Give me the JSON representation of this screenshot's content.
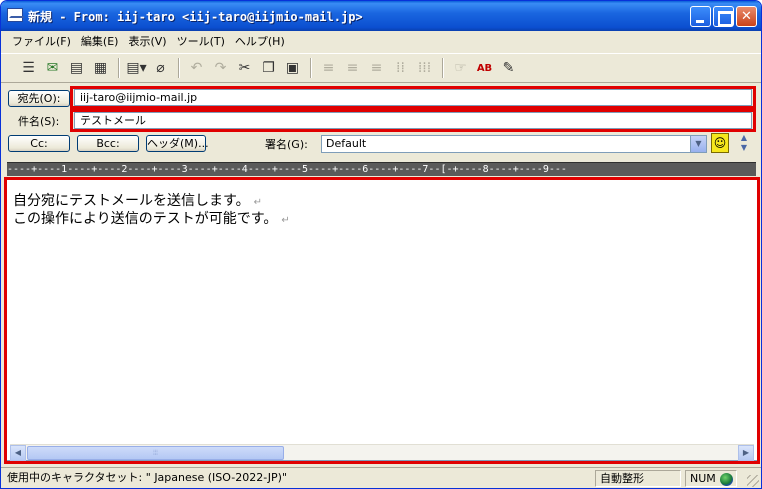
{
  "window": {
    "title": "新規 - From: iij-taro <iij-taro@iijmio-mail.jp>"
  },
  "menu": [
    "ファイル(F)",
    "編集(E)",
    "表示(V)",
    "ツール(T)",
    "ヘルプ(H)"
  ],
  "toolbar_icons": [
    "address-book-icon",
    "send-icon",
    "draft-icon",
    "template-icon",
    "format-icon",
    "attach-icon",
    "undo-icon",
    "redo-icon",
    "cut-icon",
    "copy-icon",
    "paste-icon",
    "align-left-icon",
    "align-center-icon",
    "align-right-icon",
    "indent-icon",
    "outdent-icon",
    "hand-icon",
    "spellcheck-icon",
    "edit-icon"
  ],
  "header": {
    "to_label": "宛先(O):",
    "to_value": "iij-taro@iijmio-mail.jp",
    "subject_label": "件名(S):",
    "subject_value": "テストメール",
    "cc_label": "Cc:",
    "bcc_label": "Bcc:",
    "headers_label": "ヘッダ(M)...",
    "signature_label": "署名(G):",
    "signature_value": "Default"
  },
  "ruler": "----+----1----+----2----+----3----+----4----+----5----+----6----+----7--[-+----8----+----9---",
  "body": {
    "line1": "自分宛にテストメールを送信します。",
    "line2": "この操作により送信のテストが可能です。",
    "line_end_mark": "↵"
  },
  "status": {
    "charset": "使用中のキャラクタセット: \" Japanese (ISO-2022-JP)\"",
    "wrap": "自動整形",
    "num": "NUM"
  },
  "colors": {
    "highlight": "#e00000",
    "titlebar": "#0b4fd0"
  }
}
